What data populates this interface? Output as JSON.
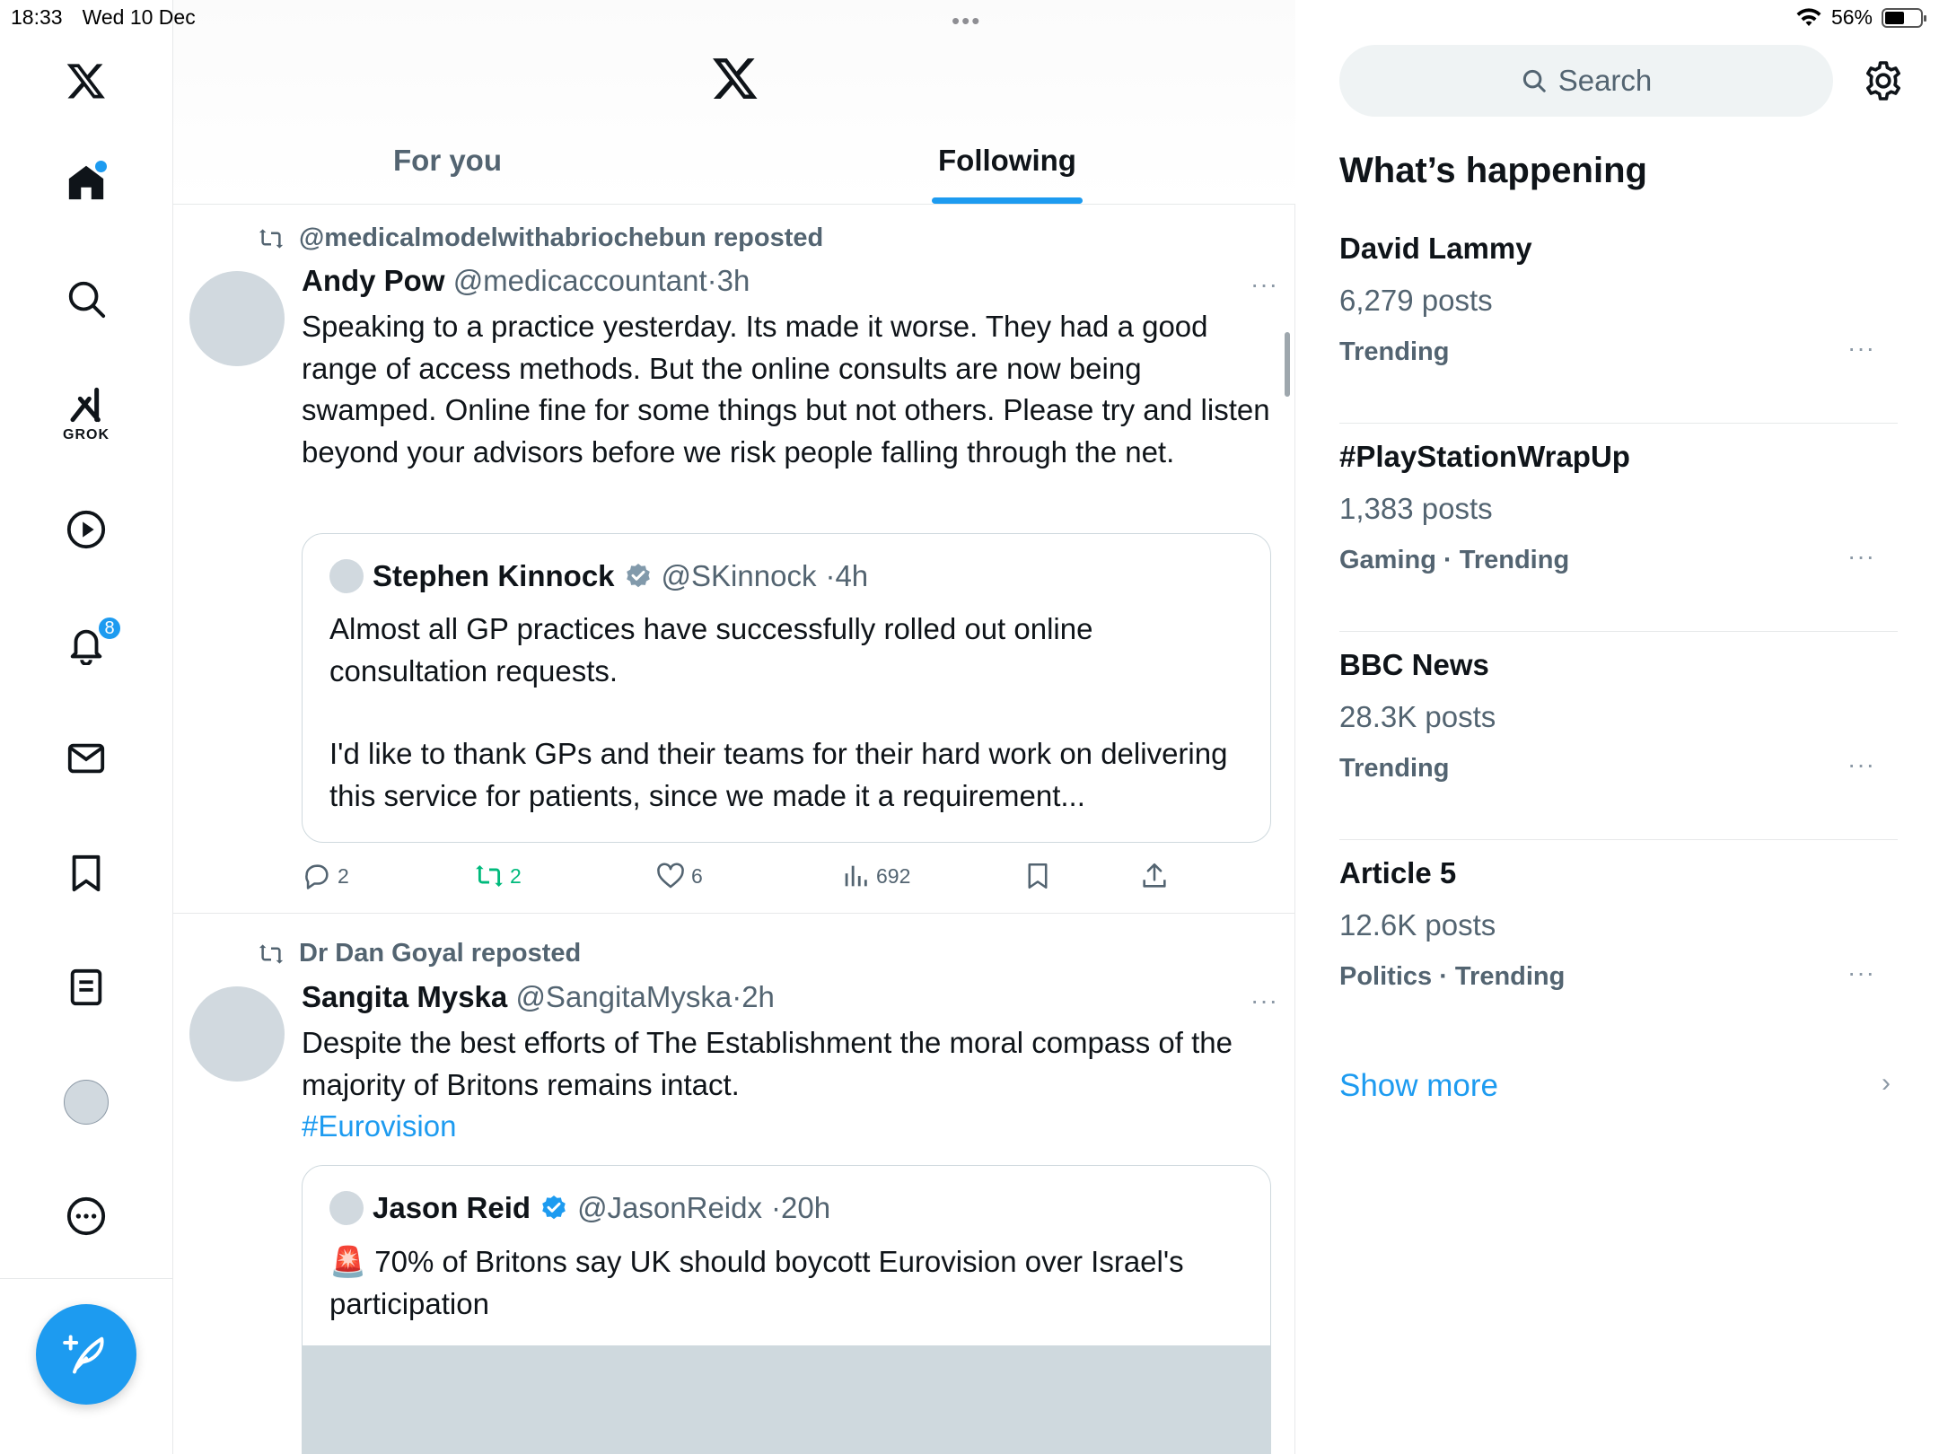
{
  "status_bar": {
    "time": "18:33",
    "date": "Wed 10 Dec",
    "battery": "56%",
    "battery_level": 0.56
  },
  "nav": {
    "grok_label": "GROK",
    "notifications_badge": "8"
  },
  "tabs": [
    {
      "label": "For you",
      "active": false
    },
    {
      "label": "Following",
      "active": true
    }
  ],
  "posts": [
    {
      "repost_by": "@medicalmodelwithabriochebun reposted",
      "name": "Andy Pow",
      "handle": "@medicaccountant",
      "time": "·3h",
      "more": "···",
      "text": "Speaking to a practice yesterday. Its made it worse. They had a good range of access methods. But the online consults are now being swamped. Online fine for some things but not others. Please try and listen beyond your advisors before we risk people falling through the net.",
      "quote": {
        "name": "Stephen Kinnock",
        "verified": "grey",
        "handle": "@SKinnock",
        "time": "·4h",
        "text_1": "Almost all GP practices have successfully rolled out online consultation requests.",
        "text_2": "I'd like to thank GPs and their teams for their hard work on delivering this service for patients, since we made it a requirement..."
      },
      "actions": {
        "replies": "2",
        "reposts": "2",
        "likes": "6",
        "views": "692"
      }
    },
    {
      "repost_by": "Dr Dan Goyal reposted",
      "name": "Sangita Myska",
      "handle": "@SangitaMyska",
      "time": "·2h",
      "more": "···",
      "text": "Despite the best efforts of The Establishment the moral compass of the majority of Britons remains intact.",
      "hashtag": "#Eurovision",
      "quote": {
        "name": "Jason Reid",
        "verified": "blue",
        "handle": "@JasonReidx",
        "time": "·20h",
        "siren": "🚨",
        "text": "70% of Britons say UK should boycott Eurovision over Israel's participation"
      }
    }
  ],
  "sidebar": {
    "search_placeholder": "Search",
    "heading": "What’s happening",
    "trends": [
      {
        "name": "David Lammy",
        "count": "6,279 posts",
        "meta": "Trending",
        "more": "···"
      },
      {
        "name": "#PlayStationWrapUp",
        "count": "1,383 posts",
        "meta": "Gaming · Trending",
        "more": "···"
      },
      {
        "name": "BBC News",
        "count": "28.3K posts",
        "meta": "Trending",
        "more": "···"
      },
      {
        "name": "Article 5",
        "count": "12.6K posts",
        "meta": "Politics · Trending",
        "more": "···"
      }
    ],
    "show_more": "Show more",
    "chevron": "›"
  },
  "colors": {
    "accent": "#1d9bf0",
    "repost_green": "#00ba7c",
    "secondary_text": "#536471",
    "border": "#e7e9ea",
    "placeholder_avatar": "#d1d9df"
  }
}
